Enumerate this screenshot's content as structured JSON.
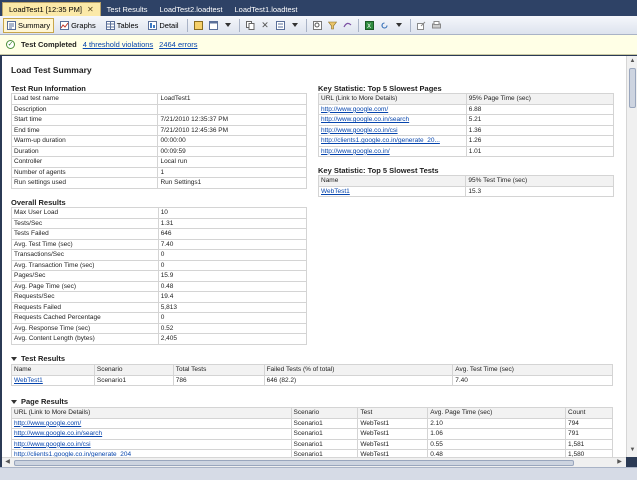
{
  "doc_tabs": [
    {
      "label": "LoadTest1 [12:35 PM]",
      "active": true
    },
    {
      "label": "Test Results",
      "active": false
    },
    {
      "label": "LoadTest2.loadtest",
      "active": false
    },
    {
      "label": "LoadTest1.loadtest",
      "active": false
    }
  ],
  "toolbar": {
    "summary": "Summary",
    "graphs": "Graphs",
    "tables": "Tables",
    "detail": "Detail"
  },
  "status": {
    "completed": "Test Completed",
    "violations": "4 threshold violations",
    "errors": "2464 errors"
  },
  "summary_title": "Load Test Summary",
  "run_info": {
    "title": "Test Run Information",
    "rows": [
      [
        "Load test name",
        "LoadTest1"
      ],
      [
        "Description",
        ""
      ],
      [
        "Start time",
        "7/21/2010 12:35:37 PM"
      ],
      [
        "End time",
        "7/21/2010 12:45:36 PM"
      ],
      [
        "Warm-up duration",
        "00:00:00"
      ],
      [
        "Duration",
        "00:09:59"
      ],
      [
        "Controller",
        "Local run"
      ],
      [
        "Number of agents",
        "1"
      ],
      [
        "Run settings used",
        "Run Settings1"
      ]
    ]
  },
  "overall": {
    "title": "Overall Results",
    "rows": [
      [
        "Max User Load",
        "10"
      ],
      [
        "Tests/Sec",
        "1.31"
      ],
      [
        "Tests Failed",
        "646"
      ],
      [
        "Avg. Test Time (sec)",
        "7.40"
      ],
      [
        "Transactions/Sec",
        "0"
      ],
      [
        "Avg. Transaction Time (sec)",
        "0"
      ],
      [
        "Pages/Sec",
        "15.9"
      ],
      [
        "Avg. Page Time (sec)",
        "0.48"
      ],
      [
        "Requests/Sec",
        "19.4"
      ],
      [
        "Requests Failed",
        "5,813"
      ],
      [
        "Requests Cached Percentage",
        "0"
      ],
      [
        "Avg. Response Time (sec)",
        "0.52"
      ],
      [
        "Avg. Content Length (bytes)",
        "2,405"
      ]
    ]
  },
  "slowest_pages": {
    "title": "Key Statistic: Top 5 Slowest Pages",
    "headers": [
      "URL (Link to More Details)",
      "95% Page Time (sec)"
    ],
    "rows": [
      [
        "http://www.google.com/",
        "6.88"
      ],
      [
        "http://www.google.co.in/search",
        "5.21"
      ],
      [
        "http://www.google.co.in/csi",
        "1.36"
      ],
      [
        "http://clients1.google.co.in/generate_20...",
        "1.26"
      ],
      [
        "http://www.google.co.in/",
        "1.01"
      ]
    ]
  },
  "slowest_tests": {
    "title": "Key Statistic: Top 5 Slowest Tests",
    "headers": [
      "Name",
      "95% Test Time (sec)"
    ],
    "rows": [
      [
        "WebTest1",
        "15.3"
      ]
    ]
  },
  "test_results": {
    "title": "Test Results",
    "headers": [
      "Name",
      "Scenario",
      "Total Tests",
      "Failed Tests (% of total)",
      "Avg. Test Time (sec)"
    ],
    "rows": [
      [
        "WebTest1",
        "Scenario1",
        "786",
        "646 (82.2)",
        "7.40"
      ]
    ]
  },
  "page_results": {
    "title": "Page Results",
    "headers": [
      "URL (Link to More Details)",
      "Scenario",
      "Test",
      "Avg. Page Time (sec)",
      "Count"
    ],
    "rows": [
      [
        "http://www.google.com/",
        "Scenario1",
        "WebTest1",
        "2.10",
        "794"
      ],
      [
        "http://www.google.co.in/search",
        "Scenario1",
        "WebTest1",
        "1.06",
        "791"
      ],
      [
        "http://www.google.co.in/csi",
        "Scenario1",
        "WebTest1",
        "0.55",
        "1,581"
      ],
      [
        "http://clients1.google.co.in/generate_204",
        "Scenario1",
        "WebTest1",
        "0.48",
        "1,580"
      ]
    ]
  }
}
